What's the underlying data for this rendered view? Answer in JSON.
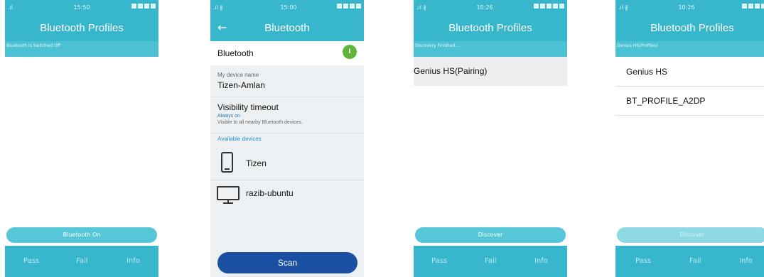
{
  "screen1": {
    "time": "15:50",
    "title": "Bluetooth Profiles",
    "status_text": "Bluetooth is Switched Off",
    "action_button": "Bluetooth On",
    "footer": {
      "pass": "Pass",
      "fail": "Fail",
      "info": "Info"
    }
  },
  "screen2": {
    "time": "15:00",
    "title": "Bluetooth",
    "bluetooth_label": "Bluetooth",
    "bluetooth_toggle": "I",
    "device_name_label": "My device name",
    "device_name_value": "Tizen-Amlan",
    "visibility_label": "Visibility timeout",
    "visibility_value": "Always on",
    "visibility_desc": "Visible to all nearby Bluetooth devices.",
    "available_label": "Available devices",
    "devices": [
      {
        "name": "Tizen",
        "icon": "phone-icon"
      },
      {
        "name": "razib-ubuntu",
        "icon": "monitor-icon"
      }
    ],
    "scan_button": "Scan"
  },
  "screen3": {
    "time": "10:26",
    "title": "Bluetooth Profiles",
    "status_text": "Discovery Finished...",
    "item": "Genius HS(Pairing)",
    "action_button": "Discover",
    "footer": {
      "pass": "Pass",
      "fail": "Fail",
      "info": "Info"
    }
  },
  "screen4": {
    "time": "10:26",
    "title": "Bluetooth Profiles",
    "status_text": "Genius HS(Profiles)",
    "items": [
      "Genius HS",
      "BT_PROFILE_A2DP"
    ],
    "action_button": "Discover",
    "footer": {
      "pass": "Pass",
      "fail": "Fail",
      "info": "Info"
    }
  },
  "colors": {
    "accent": "#37b6cc",
    "scan": "#1a4fa3",
    "toggle": "#5fb43b"
  }
}
